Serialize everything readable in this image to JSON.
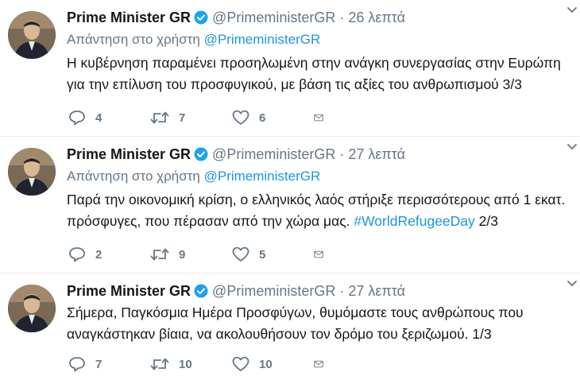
{
  "tweets": [
    {
      "name": "Prime Minister GR",
      "handle": "@PrimeministerGR",
      "separator": "·",
      "time": "26 λεπτά",
      "reply_prefix": "Απάντηση στο χρήστη",
      "reply_mention": "@PrimeministerGR",
      "text_lines": [
        "Η κυβέρνηση παραμένει προσηλωμένη στην ανάγκη συνεργασίας στην Ευρώπη",
        "για την επίλυση του προσφυγικού, με βάση τις αξίες του ανθρωπισμού 3/3"
      ],
      "replies": "4",
      "retweets": "7",
      "likes": "6"
    },
    {
      "name": "Prime Minister GR",
      "handle": "@PrimeministerGR",
      "separator": "·",
      "time": "27 λεπτά",
      "reply_prefix": "Απάντηση στο χρήστη",
      "reply_mention": "@PrimeministerGR",
      "text_line1": "Παρά την οικονομική κρίση, ο ελληνικός λαός στήριξε περισσότερους από 1 εκατ.",
      "text_line2_pre": "πρόσφυγες, που πέρασαν από την χώρα μας. ",
      "hashtag": "#WorldRefugeeDay",
      "text_line2_post": " 2/3",
      "replies": "2",
      "retweets": "9",
      "likes": "5"
    },
    {
      "name": "Prime Minister GR",
      "handle": "@PrimeministerGR",
      "separator": "·",
      "time": "27 λεπτά",
      "text_lines": [
        "Σήμερα, Παγκόσμια Ημέρα Προσφύγων, θυμόμαστε τους ανθρώπους που",
        "αναγκάστηκαν βίαια, να ακολουθήσουν τον δρόμο του ξεριζωμού. 1/3"
      ],
      "replies": "7",
      "retweets": "10",
      "likes": "10"
    }
  ],
  "icons": {
    "verified": "verified-badge-icon",
    "reply": "reply-icon",
    "retweet": "retweet-icon",
    "like": "heart-icon",
    "dm": "envelope-icon",
    "caret": "chevron-down-icon"
  },
  "colors": {
    "link": "#1b95e0",
    "secondary": "#657786",
    "verified": "#1da1f2",
    "text": "#14171a"
  }
}
